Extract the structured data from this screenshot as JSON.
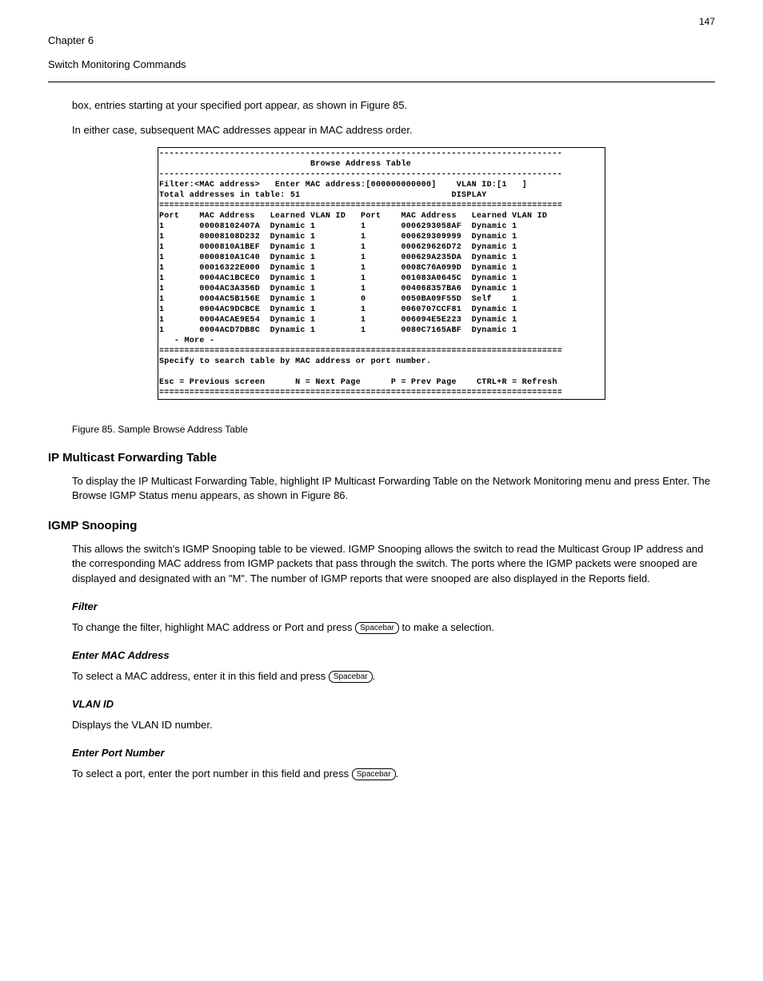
{
  "page_number": "147",
  "chapter": "Chapter 6",
  "top_section": "Switch Monitoring Commands",
  "intro_paragraphs": [
    "box, entries starting at your specified port appear, as shown in Figure 85.",
    "In either case, subsequent MAC addresses appear in MAC address order."
  ],
  "figure_caption": "Figure 85.  Sample Browse Address Table",
  "terminal": {
    "title": "Browse Address Table",
    "filter_line": "Filter:<MAC address>   Enter MAC address:[000000000000]    VLAN ID:[1   ]",
    "total_line": "Total addresses in table: 51                              DISPLAY",
    "headers_left": "Port    MAC Address   Learned VLAN ID",
    "headers_right": "Port    MAC Address   Learned VLAN ID",
    "left_rows": [
      {
        "port": "1",
        "mac": "00008102407A",
        "learned": "Dynamic",
        "vlan": "1"
      },
      {
        "port": "1",
        "mac": "00008108D232",
        "learned": "Dynamic",
        "vlan": "1"
      },
      {
        "port": "1",
        "mac": "0000810A1BEF",
        "learned": "Dynamic",
        "vlan": "1"
      },
      {
        "port": "1",
        "mac": "0000810A1C40",
        "learned": "Dynamic",
        "vlan": "1"
      },
      {
        "port": "1",
        "mac": "00016322E000",
        "learned": "Dynamic",
        "vlan": "1"
      },
      {
        "port": "1",
        "mac": "0004AC1BCEC0",
        "learned": "Dynamic",
        "vlan": "1"
      },
      {
        "port": "1",
        "mac": "0004AC3A356D",
        "learned": "Dynamic",
        "vlan": "1"
      },
      {
        "port": "1",
        "mac": "0004AC5B156E",
        "learned": "Dynamic",
        "vlan": "1"
      },
      {
        "port": "1",
        "mac": "0004AC9DCBCE",
        "learned": "Dynamic",
        "vlan": "1"
      },
      {
        "port": "1",
        "mac": "0004ACAE9E54",
        "learned": "Dynamic",
        "vlan": "1"
      },
      {
        "port": "1",
        "mac": "0004ACD7DB8C",
        "learned": "Dynamic",
        "vlan": "1"
      }
    ],
    "right_rows": [
      {
        "port": "1",
        "mac": "0006293058AF",
        "learned": "Dynamic",
        "vlan": "1"
      },
      {
        "port": "1",
        "mac": "000629309999",
        "learned": "Dynamic",
        "vlan": "1"
      },
      {
        "port": "1",
        "mac": "000629626D72",
        "learned": "Dynamic",
        "vlan": "1"
      },
      {
        "port": "1",
        "mac": "000629A235DA",
        "learned": "Dynamic",
        "vlan": "1"
      },
      {
        "port": "1",
        "mac": "0008C76A099D",
        "learned": "Dynamic",
        "vlan": "1"
      },
      {
        "port": "1",
        "mac": "001083A0645C",
        "learned": "Dynamic",
        "vlan": "1"
      },
      {
        "port": "1",
        "mac": "004068357BA6",
        "learned": "Dynamic",
        "vlan": "1"
      },
      {
        "port": "0",
        "mac": "0050BA09F55D",
        "learned": "Self",
        "vlan": "1"
      },
      {
        "port": "1",
        "mac": "0060707CCF81",
        "learned": "Dynamic",
        "vlan": "1"
      },
      {
        "port": "1",
        "mac": "006094E5E223",
        "learned": "Dynamic",
        "vlan": "1"
      },
      {
        "port": "1",
        "mac": "0080C7165ABF",
        "learned": "Dynamic",
        "vlan": "1"
      }
    ],
    "more": "   - More -",
    "instr": "Specify to search table by MAC address or port number.",
    "footer": "Esc = Previous screen      N = Next Page      P = Prev Page    CTRL+R = Refresh"
  },
  "section2_title": "IP Multicast Forwarding Table",
  "section2_body": "To display the IP Multicast Forwarding Table, highlight IP Multicast Forwarding Table on the Network Monitoring menu and press Enter. The Browse IGMP Status menu appears, as shown in Figure 86.",
  "section3_title": "IGMP Snooping",
  "section3_lead": "This allows the switch's IGMP Snooping table to be viewed. IGMP Snooping allows the switch to read the Multicast Group IP address and the corresponding MAC address from IGMP packets that pass through the switch. The ports where the IGMP packets were snooped are displayed and designated with an \"M\". The number of IGMP reports that were snooped are also displayed in the Reports field.",
  "filter_title": "Filter",
  "filter_body_before": "To change the filter, highlight MAC address or Port and press ",
  "filter_body_after": " to make a selection.",
  "enter_mac_title": "Enter MAC Address",
  "enter_mac_before": "To select a MAC address, enter it in this field and press ",
  "enter_mac_after": ".",
  "vlan_title": "VLAN ID",
  "vlan_body": "Displays the VLAN ID number.",
  "enter_port_title": "Enter Port Number",
  "enter_port_before": "To select a port, enter the port number in this field and press ",
  "enter_port_after": ".",
  "key_spacebar": "Spacebar"
}
